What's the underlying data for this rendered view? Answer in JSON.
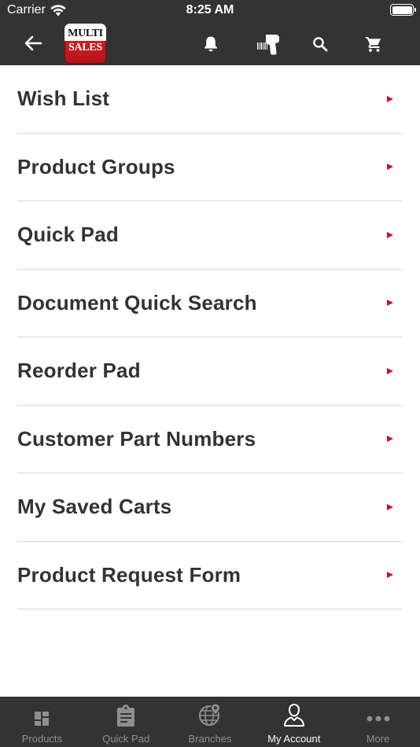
{
  "status_bar": {
    "carrier": "Carrier",
    "time": "8:25 AM",
    "wifi_icon": "wifi-icon",
    "battery_icon": "battery-icon"
  },
  "app_bar": {
    "back_icon": "back-arrow-icon",
    "logo": {
      "line1": "MULTI",
      "line2": "SALES"
    },
    "actions": [
      "bell-icon",
      "barcode-scanner-icon",
      "search-icon",
      "cart-icon"
    ]
  },
  "menu": {
    "items": [
      {
        "label": "Wish List"
      },
      {
        "label": "Product Groups"
      },
      {
        "label": "Quick Pad"
      },
      {
        "label": "Document Quick Search"
      },
      {
        "label": "Reorder Pad"
      },
      {
        "label": "Customer Part Numbers"
      },
      {
        "label": "My Saved Carts"
      },
      {
        "label": "Product Request Form"
      }
    ]
  },
  "tab_bar": {
    "tabs": [
      {
        "label": "Products",
        "icon": "grid-icon"
      },
      {
        "label": "Quick Pad",
        "icon": "clipboard-icon"
      },
      {
        "label": "Branches",
        "icon": "globe-pin-icon"
      },
      {
        "label": "My Account",
        "icon": "user-icon",
        "active": true
      },
      {
        "label": "More",
        "icon": "more-dots-icon"
      }
    ]
  },
  "colors": {
    "bar_background": "#333333",
    "accent_red": "#c8102e",
    "text": "#333333",
    "divider": "#d9d9d9",
    "tab_inactive": "#8f8f8f",
    "tab_active": "#ffffff"
  }
}
